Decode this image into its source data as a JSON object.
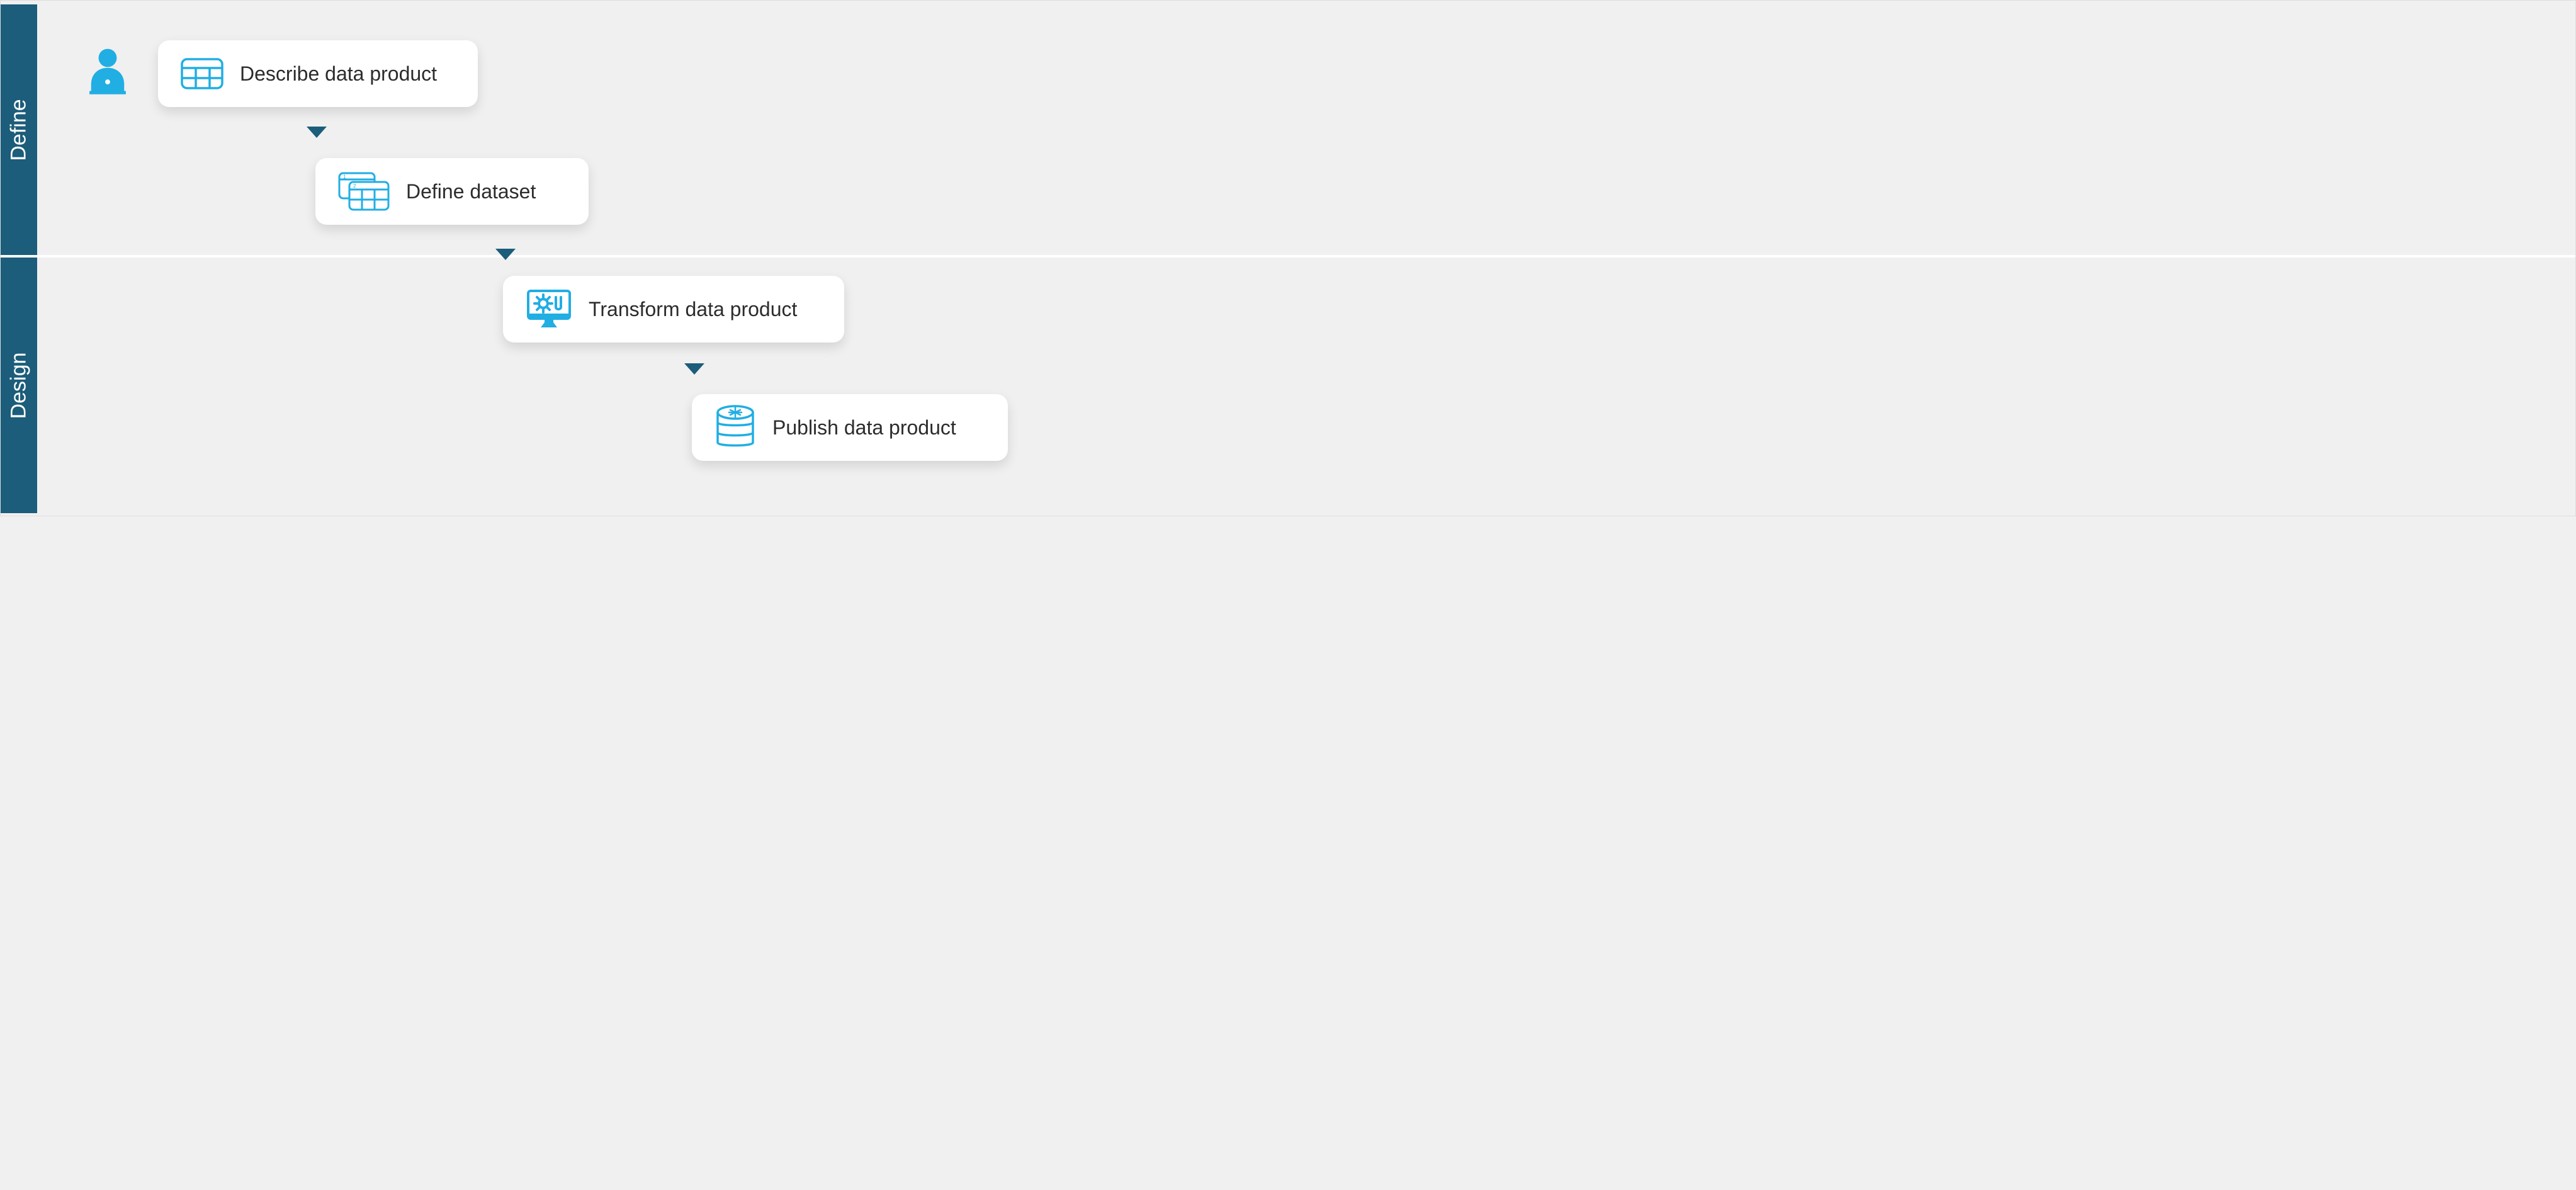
{
  "lanes": {
    "define": {
      "label": "Define"
    },
    "design": {
      "label": "Design"
    }
  },
  "steps": {
    "describe": {
      "label": "Describe data product"
    },
    "define_dataset": {
      "label": "Define dataset"
    },
    "transform": {
      "label": "Transform data product"
    },
    "publish": {
      "label": "Publish data product"
    }
  },
  "colors": {
    "accent": "#21aee3",
    "lane_bar": "#1b5d7a",
    "card_bg": "#ffffff",
    "page_bg": "#f0f0f0"
  }
}
